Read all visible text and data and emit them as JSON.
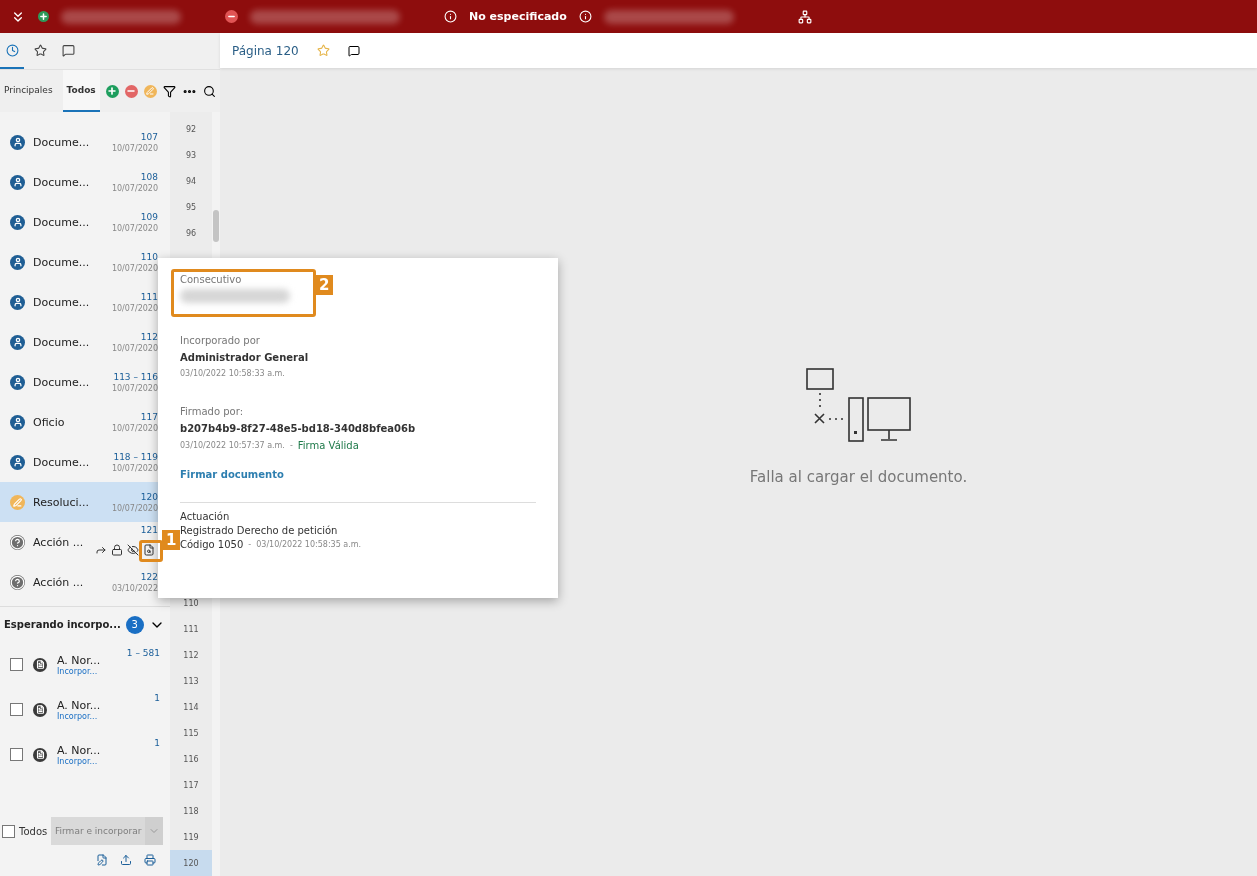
{
  "top_bar": {
    "status": "No especificado"
  },
  "side_tabs": [
    {
      "selected": true
    },
    {
      "selected": false
    },
    {
      "selected": false
    }
  ],
  "filter_tabs": [
    {
      "label": "Principales",
      "selected": false
    },
    {
      "label": "Todos",
      "selected": true
    }
  ],
  "documents": [
    {
      "kind": "document",
      "title": "Docume...",
      "pages": "107",
      "date": "10/07/2020",
      "selected": false
    },
    {
      "kind": "document",
      "title": "Docume...",
      "pages": "108",
      "date": "10/07/2020",
      "selected": false
    },
    {
      "kind": "document",
      "title": "Docume...",
      "pages": "109",
      "date": "10/07/2020",
      "selected": false
    },
    {
      "kind": "document",
      "title": "Docume...",
      "pages": "110",
      "date": "10/07/2020",
      "selected": false
    },
    {
      "kind": "document",
      "title": "Docume...",
      "pages": "111",
      "date": "10/07/2020",
      "selected": false
    },
    {
      "kind": "document",
      "title": "Docume...",
      "pages": "112",
      "date": "10/07/2020",
      "selected": false
    },
    {
      "kind": "document",
      "title": "Docume...",
      "pages": "113 – 116",
      "date": "10/07/2020",
      "selected": false
    },
    {
      "kind": "document",
      "title": "Oficio",
      "pages": "117",
      "date": "10/07/2020",
      "selected": false
    },
    {
      "kind": "document",
      "title": "Docume...",
      "pages": "118 – 119",
      "date": "10/07/2020",
      "selected": false
    },
    {
      "kind": "resolution",
      "title": "Resoluci...",
      "pages": "120",
      "date": "10/07/2020",
      "selected": true
    },
    {
      "kind": "action",
      "title": "Acción ...",
      "pages": "121",
      "hovered": true,
      "callout": "1",
      "selected": false
    },
    {
      "kind": "action",
      "title": "Acción ...",
      "pages": "122",
      "date": "03/10/2022",
      "selected": false
    }
  ],
  "waiting": {
    "title": "Esperando incorpo...",
    "count": "3",
    "expanded": true,
    "items": [
      {
        "title": "A. Nor...",
        "subtitle": "Incorpor...",
        "pages": "1 – 581",
        "checked": false
      },
      {
        "title": "A. Nor...",
        "subtitle": "Incorpor...",
        "pages": "1",
        "checked": false
      },
      {
        "title": "A. Nor...",
        "subtitle": "Incorpor...",
        "pages": "1",
        "checked": false
      }
    ]
  },
  "footer": {
    "select_all": {
      "label": "Todos",
      "checked": false
    },
    "sign_button": {
      "label": "Firmar e incorporar",
      "disabled": true
    }
  },
  "page_numbers_top": [
    {
      "label": "92",
      "selected": false
    },
    {
      "label": "93",
      "selected": false
    },
    {
      "label": "94",
      "selected": false
    },
    {
      "label": "95",
      "selected": false
    },
    {
      "label": "96",
      "selected": false
    }
  ],
  "page_numbers_bottom": [
    {
      "label": "110",
      "selected": false
    },
    {
      "label": "111",
      "selected": false
    },
    {
      "label": "112",
      "selected": false
    },
    {
      "label": "113",
      "selected": false
    },
    {
      "label": "114",
      "selected": false
    },
    {
      "label": "115",
      "selected": false
    },
    {
      "label": "116",
      "selected": false
    },
    {
      "label": "117",
      "selected": false
    },
    {
      "label": "118",
      "selected": false
    },
    {
      "label": "119",
      "selected": false
    },
    {
      "label": "120",
      "selected": true
    }
  ],
  "viewer": {
    "page_title": "Página 120",
    "error": "Falla al cargar el documento."
  },
  "popup": {
    "consecutive_label": "Consecutivo",
    "consecutive_callout": "2",
    "incorporated_label": "Incorporado por",
    "incorporated_by": "Administrador General",
    "incorporated_date": "03/10/2022 10:58:33 a.m.",
    "signed_label": "Firmado por:",
    "signed_by": "b207b4b9-8f27-48e5-bd18-340d8bfea06b",
    "signed_date": "03/10/2022 10:57:37 a.m.",
    "signed_separator": "-",
    "signature_status": "Firma Válida",
    "sign_link": "Firmar documento",
    "action_label": "Actuación",
    "action_name": "Registrado Derecho de petición",
    "action_code": "Código 1050",
    "action_separator": "-",
    "action_date": "03/10/2022 10:58:35 a.m."
  }
}
